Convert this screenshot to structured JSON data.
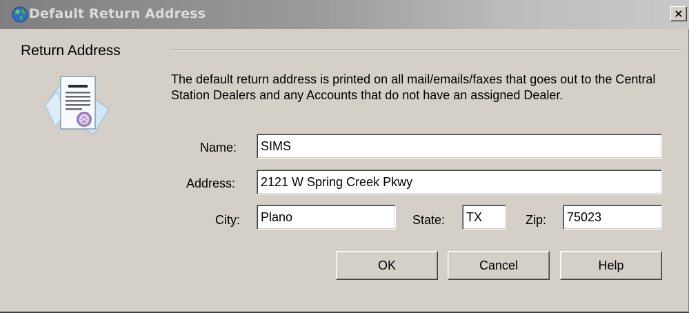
{
  "window": {
    "title": "Default Return Address",
    "title_icon": "globe-icon",
    "close_label": "×"
  },
  "group": {
    "label": "Return Address",
    "icon": "document-certificate-icon"
  },
  "description": "The default return address is printed on all mail/emails/faxes that goes out to the Central Station Dealers and any Accounts that do not have an assigned Dealer.",
  "form": {
    "name_label": "Name:",
    "name_value": "SIMS",
    "address_label": "Address:",
    "address_value": "2121 W Spring Creek Pkwy",
    "city_label": "City:",
    "city_value": "Plano",
    "state_label": "State:",
    "state_value": "TX",
    "zip_label": "Zip:",
    "zip_value": "75023"
  },
  "buttons": {
    "ok": "OK",
    "cancel": "Cancel",
    "help": "Help"
  },
  "colors": {
    "dialog_background": "#d4d0c8",
    "titlebar_start": "#7f7f7f",
    "titlebar_end": "#c9c9c9",
    "input_background": "#ffffff"
  }
}
